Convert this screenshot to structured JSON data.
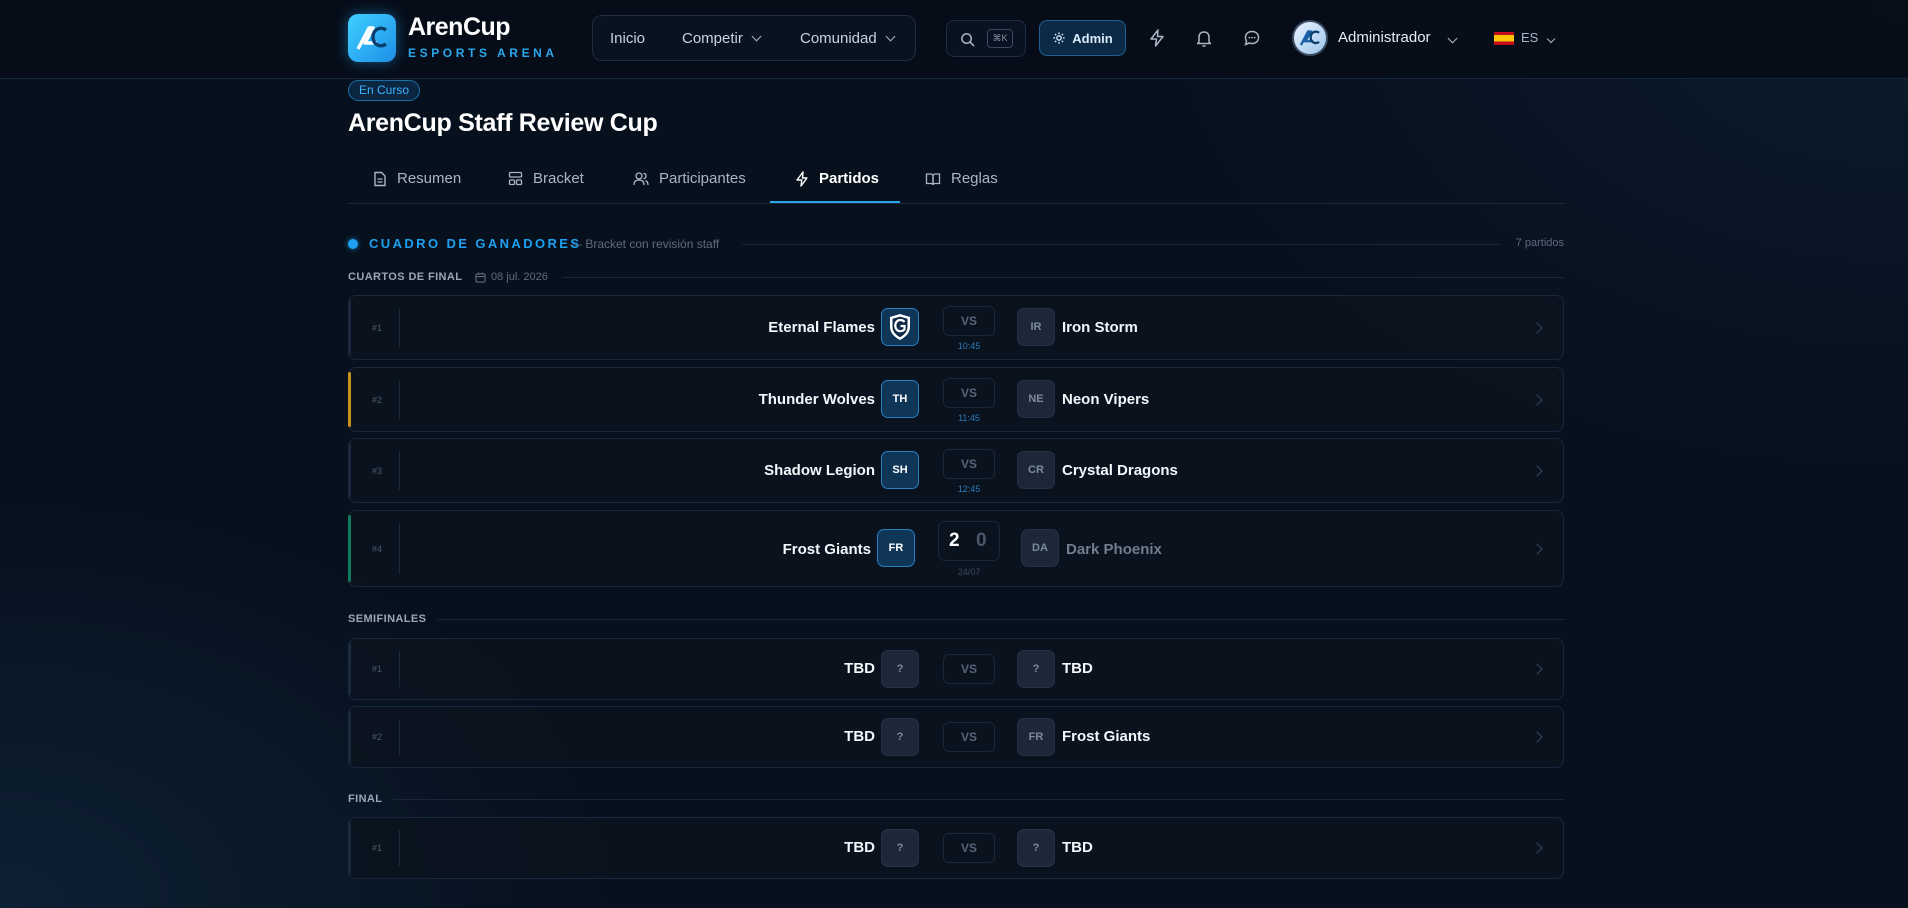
{
  "app": {
    "name": "ArenCup",
    "tagline": "ESPORTS ARENA"
  },
  "nav": {
    "items": [
      {
        "label": "Inicio"
      },
      {
        "label": "Competir"
      },
      {
        "label": "Comunidad"
      }
    ]
  },
  "header": {
    "search_shortcut": "⌘K",
    "admin_label": "Admin",
    "user_name": "Administrador",
    "language": "ES"
  },
  "tournament": {
    "status": "En Curso",
    "title": "ArenCup Staff Review Cup"
  },
  "tabs": [
    {
      "label": "Resumen",
      "icon": "document-icon"
    },
    {
      "label": "Bracket",
      "icon": "bracket-icon"
    },
    {
      "label": "Participantes",
      "icon": "users-icon"
    },
    {
      "label": "Partidos",
      "icon": "bolt-icon",
      "active": true
    },
    {
      "label": "Reglas",
      "icon": "book-icon"
    }
  ],
  "section": {
    "title": "CUADRO DE GANADORES",
    "subtitle": "— Bracket con revisión staff",
    "count": "7 partidos"
  },
  "rounds": [
    {
      "name": "CUARTOS DE FINAL",
      "date": "08 jul. 2026",
      "matches": [
        {
          "num": "#1",
          "team_a": "Eternal Flames",
          "badge_a": "",
          "team_b": "Iron Storm",
          "badge_b": "IR",
          "vs": "VS",
          "time": "10:45"
        },
        {
          "num": "#2",
          "team_a": "Thunder Wolves",
          "badge_a": "TH",
          "team_b": "Neon Vipers",
          "badge_b": "NE",
          "vs": "VS",
          "time": "11:45"
        },
        {
          "num": "#3",
          "team_a": "Shadow Legion",
          "badge_a": "SH",
          "team_b": "Crystal Dragons",
          "badge_b": "CR",
          "vs": "VS",
          "time": "12:45"
        },
        {
          "num": "#4",
          "team_a": "Frost Giants",
          "badge_a": "FR",
          "team_b": "Dark Phoenix",
          "badge_b": "DA",
          "score_a": "2",
          "score_b": "0",
          "time": "24/07"
        }
      ]
    },
    {
      "name": "SEMIFINALES",
      "matches": [
        {
          "num": "#1",
          "team_a": "TBD",
          "badge_a": "?",
          "team_b": "TBD",
          "badge_b": "?",
          "vs": "VS"
        },
        {
          "num": "#2",
          "team_a": "TBD",
          "badge_a": "?",
          "team_b": "Frost Giants",
          "badge_b": "FR",
          "vs": "VS"
        }
      ]
    },
    {
      "name": "FINAL",
      "matches": [
        {
          "num": "#1",
          "team_a": "TBD",
          "badge_a": "?",
          "team_b": "TBD",
          "badge_b": "?",
          "vs": "VS"
        }
      ]
    }
  ],
  "colors": {
    "accent": "#1ea1f2",
    "background": "#07101d",
    "highlight_gold": "#c8911a",
    "highlight_green": "#0f7a5e"
  }
}
